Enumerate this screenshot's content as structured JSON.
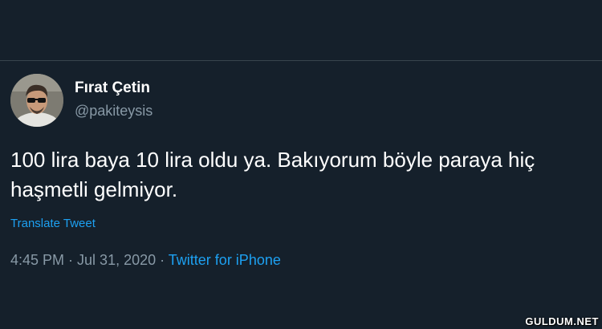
{
  "tweet": {
    "author": {
      "display_name": "Fırat Çetin",
      "handle": "@pakiteysis"
    },
    "text": "100 lira baya 10 lira oldu ya. Bakıyorum böyle paraya hiç haşmetli gelmiyor.",
    "translate_label": "Translate Tweet",
    "time": "4:45 PM",
    "separator": " · ",
    "date": "Jul 31, 2020",
    "source": "Twitter for iPhone"
  },
  "watermark": "GULDUM.NET",
  "colors": {
    "background": "#15202b",
    "link": "#1da1f2",
    "secondary_text": "#8899a6",
    "divider": "#38444d"
  }
}
